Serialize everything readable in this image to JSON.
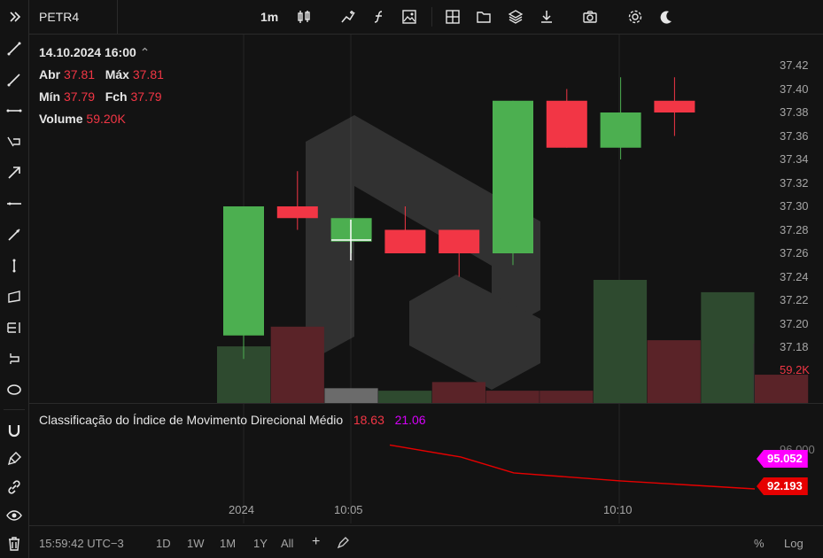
{
  "toolbar": {
    "symbol": "PETR4",
    "interval": "1m",
    "expand_icon": "double-chevron-right-icon"
  },
  "legend": {
    "datetime": "14.10.2024 16:00",
    "open_label": "Abr",
    "open_value": "37.81",
    "high_label": "Máx",
    "high_value": "37.81",
    "low_label": "Mín",
    "low_value": "37.79",
    "close_label": "Fch",
    "close_value": "37.79",
    "volume_label": "Volume",
    "volume_value": "59.20K"
  },
  "price_axis": {
    "ticks": [
      "37.42",
      "37.40",
      "37.38",
      "37.36",
      "37.34",
      "37.32",
      "37.30",
      "37.28",
      "37.26",
      "37.24",
      "37.22",
      "37.20",
      "37.18"
    ],
    "volume_tag": "59.2K"
  },
  "indicator": {
    "title": "Classificação do Índice de Movimento Direcional Médio",
    "value1": "18.63",
    "value2": "21.06",
    "axis_partial": "96.000",
    "tag1": "95.052",
    "tag2": "92.193"
  },
  "time_axis": {
    "labels": [
      "2024",
      "10:05",
      "10:10"
    ]
  },
  "bottom": {
    "clock": "15:59:42 UTC−3",
    "ranges": [
      "1D",
      "1W",
      "1M",
      "1Y",
      "All"
    ],
    "percent": "%",
    "log": "Log"
  },
  "colors": {
    "up": "#4caf50",
    "down": "#f23645",
    "background": "#131313",
    "magenta": "#ff00ff",
    "red_line": "#e60000"
  },
  "chart_data": {
    "type": "candlestick",
    "candles": [
      {
        "open": 37.19,
        "high": 37.3,
        "low": 37.17,
        "close": 37.3
      },
      {
        "open": 37.3,
        "high": 37.33,
        "low": 37.28,
        "close": 37.29
      },
      {
        "open": 37.27,
        "high": 37.29,
        "low": 37.26,
        "close": 37.29
      },
      {
        "open": 37.28,
        "high": 37.3,
        "low": 37.26,
        "close": 37.26
      },
      {
        "open": 37.28,
        "high": 37.28,
        "low": 37.24,
        "close": 37.26
      },
      {
        "open": 37.26,
        "high": 37.39,
        "low": 37.25,
        "close": 37.39
      },
      {
        "open": 37.39,
        "high": 37.4,
        "low": 37.35,
        "close": 37.35
      },
      {
        "open": 37.35,
        "high": 37.41,
        "low": 37.34,
        "close": 37.38
      },
      {
        "open": 37.39,
        "high": 37.41,
        "low": 37.36,
        "close": 37.38
      }
    ],
    "volume_relative": [
      0.46,
      0.62,
      0.12,
      0.1,
      0.17,
      0.1,
      0.1,
      1.0,
      0.51,
      0.9,
      0.23
    ],
    "volume_colors": [
      "up",
      "down",
      "neutral",
      "up",
      "down",
      "down",
      "down",
      "up",
      "down",
      "up",
      "down"
    ],
    "adxr": [
      95.5,
      94.6,
      93.4,
      92.8,
      92.193
    ],
    "adx_ylim": [
      91.5,
      96.5
    ],
    "ylim": [
      37.17,
      37.43
    ]
  }
}
